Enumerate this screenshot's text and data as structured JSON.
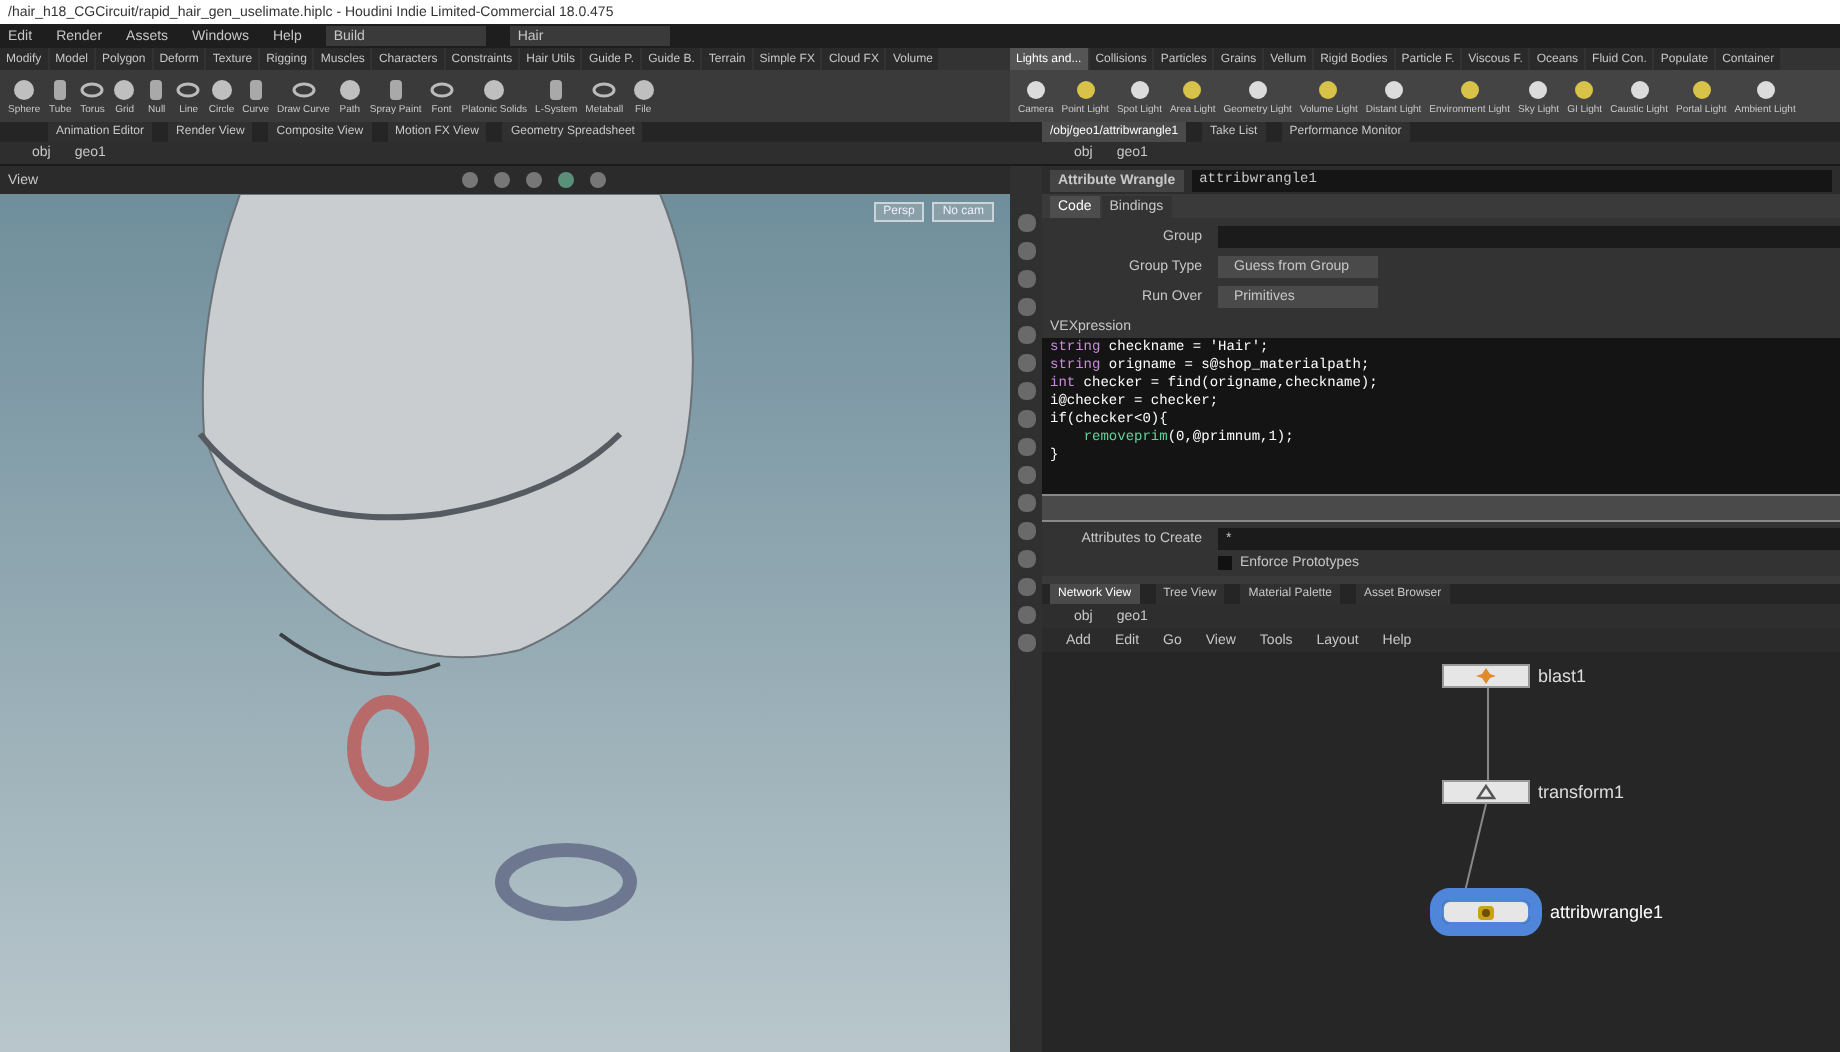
{
  "title": "/hair_h18_CGCircuit/rapid_hair_gen_uselimate.hiplc - Houdini Indie Limited-Commercial 18.0.475",
  "menus": [
    "Edit",
    "Render",
    "Assets",
    "Windows",
    "Help"
  ],
  "desktops": [
    {
      "label": "Build"
    },
    {
      "label": "Hair"
    }
  ],
  "shelf_tabs_left": [
    {
      "label": "Modify",
      "selected": false
    },
    {
      "label": "Model",
      "selected": false
    },
    {
      "label": "Polygon",
      "selected": false
    },
    {
      "label": "Deform",
      "selected": false
    },
    {
      "label": "Texture",
      "selected": false
    },
    {
      "label": "Rigging",
      "selected": false
    },
    {
      "label": "Muscles",
      "selected": false
    },
    {
      "label": "Characters",
      "selected": false
    },
    {
      "label": "Constraints",
      "selected": false
    },
    {
      "label": "Hair Utils",
      "selected": false
    },
    {
      "label": "Guide P.",
      "selected": false
    },
    {
      "label": "Guide B.",
      "selected": false
    },
    {
      "label": "Terrain",
      "selected": false
    },
    {
      "label": "Simple FX",
      "selected": false
    },
    {
      "label": "Cloud FX",
      "selected": false
    },
    {
      "label": "Volume",
      "selected": false
    }
  ],
  "shelf_tabs_right": [
    {
      "label": "Lights and...",
      "selected": true
    },
    {
      "label": "Collisions",
      "selected": false
    },
    {
      "label": "Particles",
      "selected": false
    },
    {
      "label": "Grains",
      "selected": false
    },
    {
      "label": "Vellum",
      "selected": false
    },
    {
      "label": "Rigid Bodies",
      "selected": false
    },
    {
      "label": "Particle F.",
      "selected": false
    },
    {
      "label": "Viscous F.",
      "selected": false
    },
    {
      "label": "Oceans",
      "selected": false
    },
    {
      "label": "Fluid Con.",
      "selected": false
    },
    {
      "label": "Populate",
      "selected": false
    },
    {
      "label": "Container",
      "selected": false
    }
  ],
  "shelf_tools_left": [
    "Sphere",
    "Tube",
    "Torus",
    "Grid",
    "Null",
    "Line",
    "Circle",
    "Curve",
    "Draw Curve",
    "Path",
    "Spray Paint",
    "Font",
    "Platonic Solids",
    "L-System",
    "Metaball",
    "File"
  ],
  "shelf_tools_right": [
    "Camera",
    "Point Light",
    "Spot Light",
    "Area Light",
    "Geometry Light",
    "Volume Light",
    "Distant Light",
    "Environment Light",
    "Sky Light",
    "GI Light",
    "Caustic Light",
    "Portal Light",
    "Ambient Light"
  ],
  "pane_tabs_left": [
    {
      "label": "Animation Editor",
      "selected": false
    },
    {
      "label": "Render View",
      "selected": false
    },
    {
      "label": "Composite View",
      "selected": false
    },
    {
      "label": "Motion FX View",
      "selected": false
    },
    {
      "label": "Geometry Spreadsheet",
      "selected": false
    }
  ],
  "pane_tabs_right": [
    {
      "label": "/obj/geo1/attribwrangle1",
      "selected": true
    },
    {
      "label": "Take List",
      "selected": false
    },
    {
      "label": "Performance Monitor",
      "selected": false
    }
  ],
  "path_left": [
    "obj",
    "geo1"
  ],
  "path_right": [
    "obj",
    "geo1"
  ],
  "viewport": {
    "label": "View",
    "camera_buttons": [
      "Persp",
      "No cam"
    ]
  },
  "parameters": {
    "node_type": "Attribute Wrangle",
    "node_name": "attribwrangle1",
    "tabs": [
      {
        "label": "Code",
        "selected": true
      },
      {
        "label": "Bindings",
        "selected": false
      }
    ],
    "fields": [
      {
        "kind": "text",
        "label": "Group"
      },
      {
        "kind": "menu",
        "label": "Group Type",
        "value": "Guess from Group"
      },
      {
        "kind": "menu",
        "label": "Run Over",
        "value": "Primitives"
      }
    ],
    "code_label": "VEXpression",
    "code": [
      "string checkname = 'Hair';",
      "string origname = s@shop_materialpath;",
      "int checker = find(origname,checkname);",
      "i@checker = checker;",
      "if(checker<0){",
      "    removeprim(0,@primnum,1);",
      "}"
    ],
    "attributes_to_create": {
      "label": "Attributes to Create",
      "value": "*"
    },
    "enforce_prototypes": {
      "label": "Enforce Prototypes",
      "checked": false
    }
  },
  "network": {
    "tabs": [
      {
        "label": "Network View",
        "selected": true
      },
      {
        "label": "Tree View",
        "selected": false
      },
      {
        "label": "Material Palette",
        "selected": false
      },
      {
        "label": "Asset Browser",
        "selected": false
      }
    ],
    "path": [
      "obj",
      "geo1"
    ],
    "menus": [
      "Add",
      "Edit",
      "Go",
      "View",
      "Tools",
      "Layout",
      "Help"
    ],
    "nodes": [
      {
        "name": "blast1",
        "kind": "blast",
        "selected": false
      },
      {
        "name": "transform1",
        "kind": "transform",
        "selected": false
      },
      {
        "name": "attribwrangle1",
        "kind": "wrangle",
        "selected": true
      }
    ]
  }
}
